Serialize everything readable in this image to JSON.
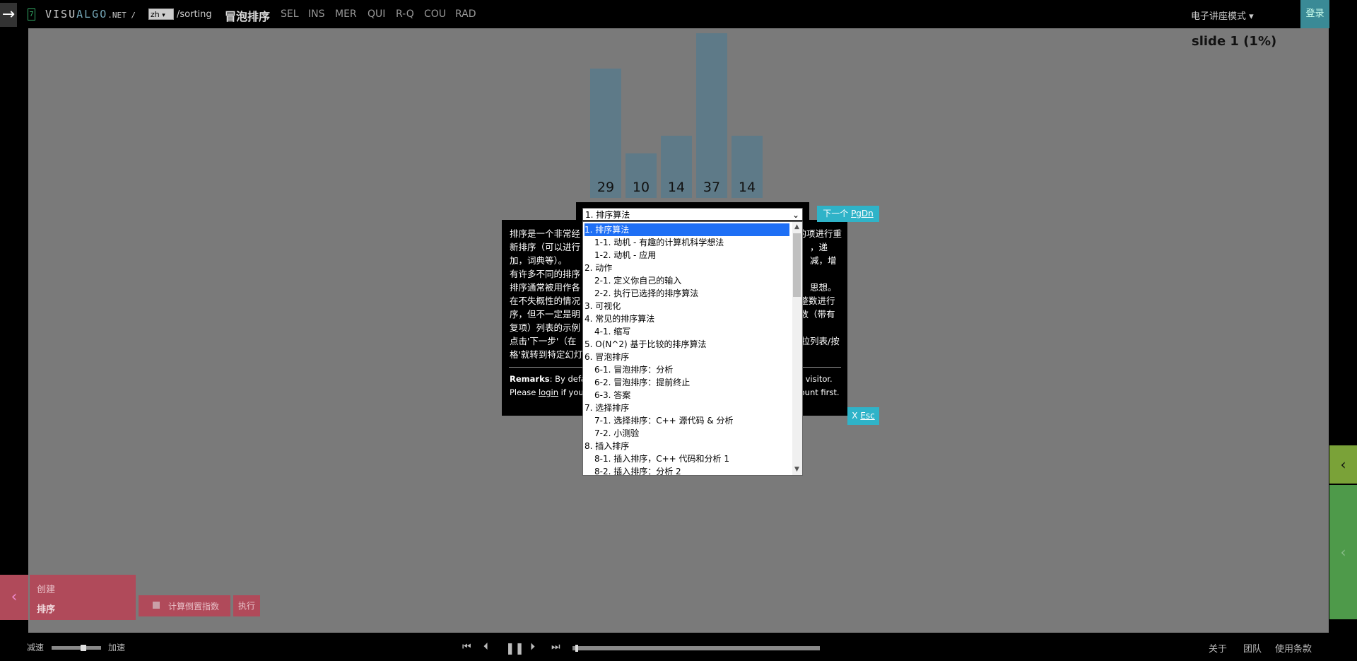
{
  "topbar": {
    "logo_box": "7",
    "logo_prefix": "VISU",
    "logo_mid": "ALGO",
    "logo_suffix": ".NET /",
    "language": "zh",
    "path": "/sorting",
    "algo_title": "冒泡排序",
    "tabs": [
      "SEL",
      "INS",
      "MER",
      "QUI",
      "R-Q",
      "COU",
      "RAD"
    ],
    "mode": "电子讲座模式 ▾",
    "login": "登录"
  },
  "stage": {
    "slide_counter": "slide 1 (1%)"
  },
  "chart_data": {
    "type": "bar",
    "values": [
      29,
      10,
      14,
      37,
      14
    ],
    "categories": [
      "29",
      "10",
      "14",
      "37",
      "14"
    ],
    "color": "#5e7a88"
  },
  "dialog": {
    "slide_select": "1. 排序算法",
    "next_label": "下一个",
    "next_key": "PgDn",
    "esc_label": "X",
    "esc_key": "Esc",
    "paragraphs": [
      "排序是一个非常经",
      "新排序（可以进行",
      "加，词典等）。",
      "有许多不同的排序",
      "排序通常被用作各",
      "在不失概性的情况",
      "序，但不一定是明",
      "复项）列表的示例",
      "点击'下一步'（在",
      "格'就转到特定幻灯"
    ],
    "paragraphs_right": [
      "中的项进行重",
      "，递减，增",
      "",
      "",
      "思想。",
      "对整数进行排",
      "整数（带有重",
      "",
      "下拉列表/按空",
      ""
    ],
    "remarks_bold": "Remarks",
    "remarks_1": ": By defau",
    "remarks_1_right": "in) visitor.",
    "remarks_2_pre": "Please ",
    "remarks_2_link": "login",
    "remarks_2_post": " if you",
    "remarks_2_right": "ccount first."
  },
  "dropdown": {
    "items": [
      {
        "label": "1. 排序算法",
        "selected": true,
        "sub": false
      },
      {
        "label": "1-1. 动机 - 有趣的计算机科学想法",
        "selected": false,
        "sub": true
      },
      {
        "label": "1-2. 动机 - 应用",
        "selected": false,
        "sub": true
      },
      {
        "label": "2. 动作",
        "selected": false,
        "sub": false
      },
      {
        "label": "2-1. 定义你自己的输入",
        "selected": false,
        "sub": true
      },
      {
        "label": "2-2. 执行已选择的排序算法",
        "selected": false,
        "sub": true
      },
      {
        "label": "3. 可视化",
        "selected": false,
        "sub": false
      },
      {
        "label": "4. 常见的排序算法",
        "selected": false,
        "sub": false
      },
      {
        "label": "4-1. 缩写",
        "selected": false,
        "sub": true
      },
      {
        "label": "5. O(N^2) 基于比较的排序算法",
        "selected": false,
        "sub": false
      },
      {
        "label": "6. 冒泡排序",
        "selected": false,
        "sub": false
      },
      {
        "label": "6-1. 冒泡排序：分析",
        "selected": false,
        "sub": true
      },
      {
        "label": "6-2. 冒泡排序：提前终止",
        "selected": false,
        "sub": true
      },
      {
        "label": "6-3. 答案",
        "selected": false,
        "sub": true
      },
      {
        "label": "7. 选择排序",
        "selected": false,
        "sub": false
      },
      {
        "label": "7-1. 选择排序：C++ 源代码 & 分析",
        "selected": false,
        "sub": true
      },
      {
        "label": "7-2. 小测验",
        "selected": false,
        "sub": true
      },
      {
        "label": "8. 插入排序",
        "selected": false,
        "sub": false
      },
      {
        "label": "8-1. 插入排序，C++ 代码和分析 1",
        "selected": false,
        "sub": true
      },
      {
        "label": "8-2. 插入排序：分析 2",
        "selected": false,
        "sub": true
      }
    ]
  },
  "left_panel": {
    "create": "创建",
    "sort": "排序",
    "inversion": "计算倒置指数",
    "run": "执行"
  },
  "bottombar": {
    "slow": "减速",
    "fast": "加速",
    "speed_fraction": 0.64,
    "progress_fraction": 0.01,
    "about": "关于",
    "team": "团队",
    "terms": "使用条款"
  }
}
